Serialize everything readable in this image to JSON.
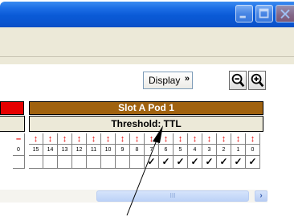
{
  "toolbar": {
    "display_label": "Display",
    "dropdown_arrow": "»",
    "zoom_out_icon": "zoom-out-icon",
    "zoom_in_icon": "zoom-in-icon"
  },
  "grid": {
    "slot_header": "Slot A Pod 1",
    "threshold_label": "Threshold: TTL",
    "left_partial_number": "0",
    "channels": [
      "15",
      "14",
      "13",
      "12",
      "11",
      "10",
      "9",
      "8",
      "7",
      "6",
      "5",
      "4",
      "3",
      "2",
      "1",
      "0"
    ],
    "arrow_symbol": "↕",
    "check_symbol": "✓",
    "left_dash": "–",
    "checked_from_index": 8,
    "colors": {
      "header_brown": "#a0620f",
      "red_bar": "#e60000",
      "arrow_red": "#e00000"
    }
  },
  "scrollbar": {
    "thumb_grip": "III",
    "right_arrow": "›"
  }
}
